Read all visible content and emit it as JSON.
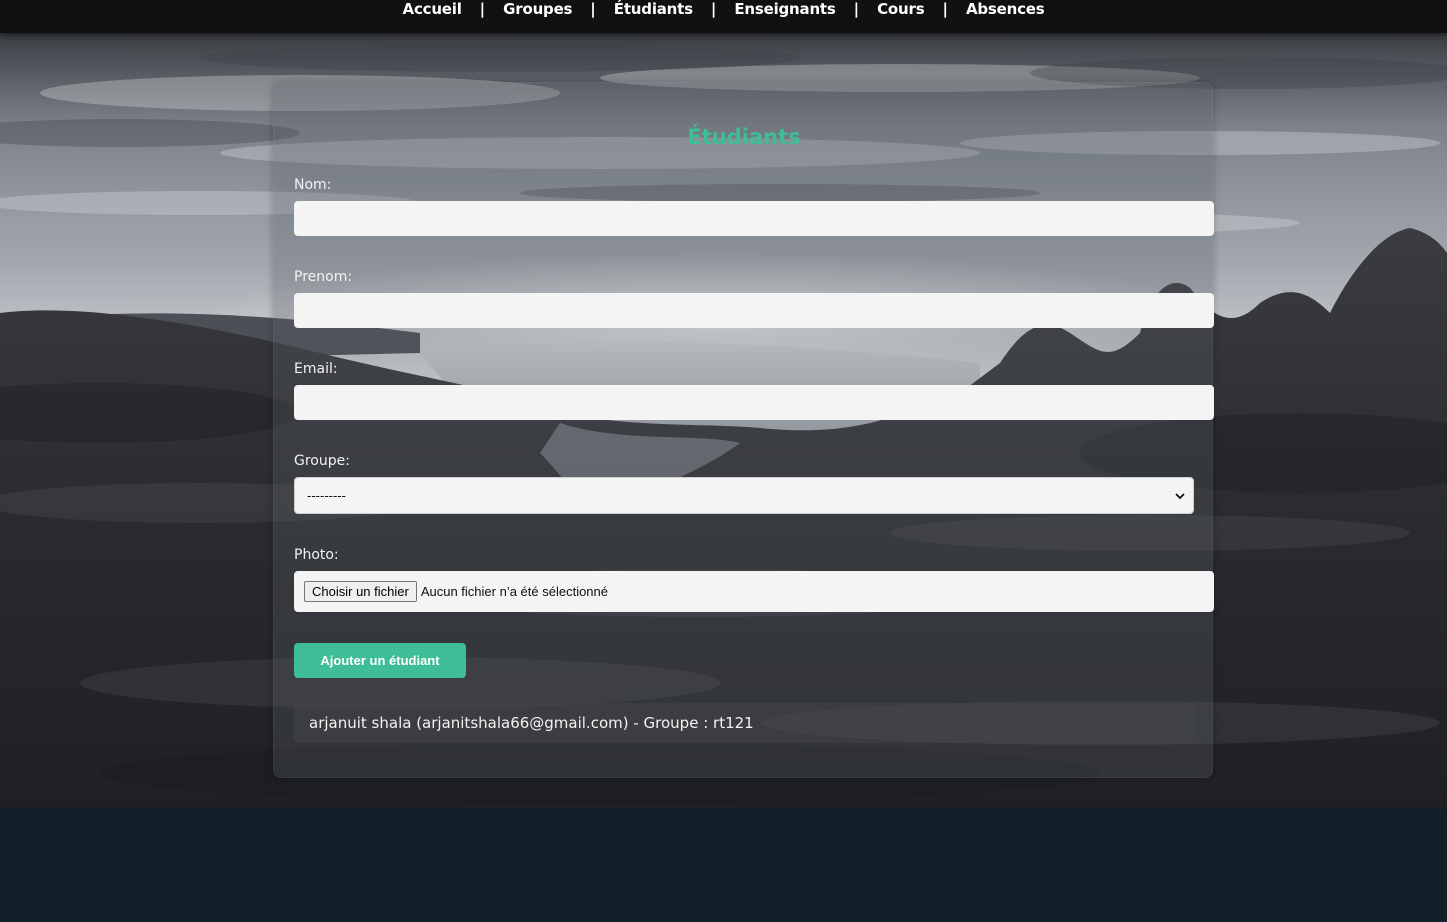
{
  "nav": {
    "items": [
      {
        "label": "Accueil"
      },
      {
        "label": "Groupes"
      },
      {
        "label": "Étudiants"
      },
      {
        "label": "Enseignants"
      },
      {
        "label": "Cours"
      },
      {
        "label": "Absences"
      }
    ],
    "separator": "|"
  },
  "form": {
    "title": "Étudiants",
    "nom_label": "Nom:",
    "nom_value": "",
    "prenom_label": "Prenom:",
    "prenom_value": "",
    "email_label": "Email:",
    "email_value": "",
    "groupe_label": "Groupe:",
    "groupe_selected": "---------",
    "photo_label": "Photo:",
    "file_button_label": "Choisir un fichier",
    "file_status": "Aucun fichier n’a été sélectionné",
    "submit_label": "Ajouter un étudiant"
  },
  "students": [
    {
      "text": "arjanuit shala (arjanitshala66@gmail.com) - Groupe : rt121"
    }
  ],
  "colors": {
    "accent": "#3ebd96",
    "navbar": "#111111",
    "page_bottom": "#12202a"
  }
}
